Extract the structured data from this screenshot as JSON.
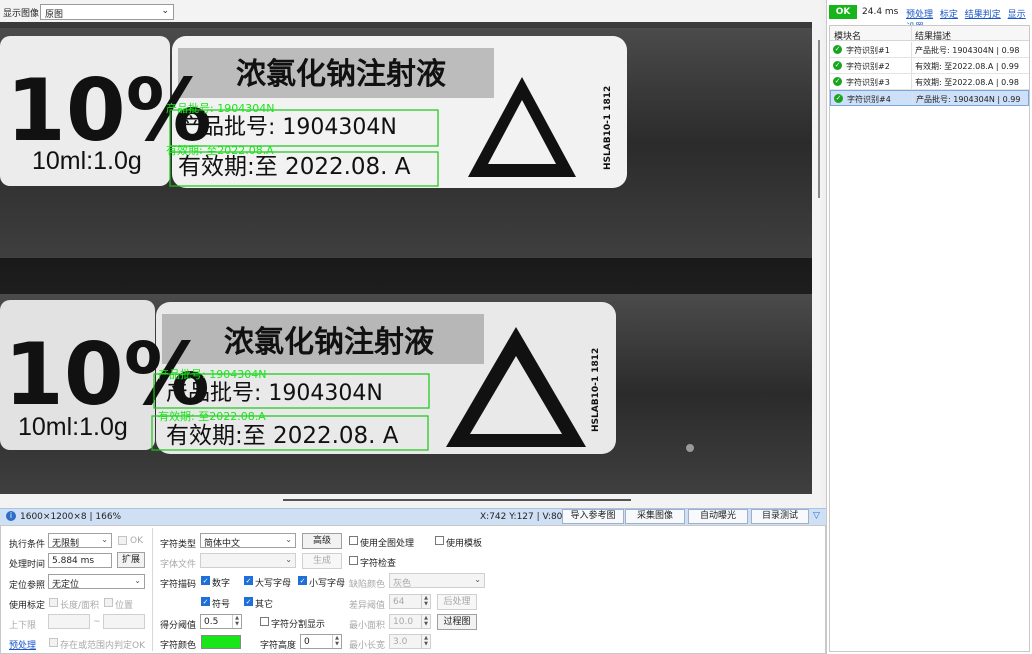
{
  "top": {
    "show_image_label": "显示图像",
    "show_image_value": "原图"
  },
  "viewport": {
    "vial_1": {
      "percent": "10%",
      "volume": "10ml:1.0g",
      "drug_name": "浓氯化钠注射液",
      "batch": "产品批号: 1904304N",
      "expiry": "有效期:至 2022.08. A",
      "lot_code": "HSLAB10-1 1812",
      "ocr_batch": "产品批号: 1904304N",
      "ocr_expiry": "有效期: 至2022.08.A"
    },
    "vial_2": {
      "percent": "10%",
      "volume": "10ml:1.0g",
      "drug_name": "浓氯化钠注射液",
      "batch": "产品批号: 1904304N",
      "expiry": "有效期:至 2022.08. A",
      "lot_code": "HSLAB10-1 1812",
      "ocr_batch": "产品批号: 1904304N",
      "ocr_expiry": "有效期: 至2022.08.A"
    }
  },
  "status": {
    "image_info": "1600×1200×8 | 166%",
    "coords": "X:742 Y:127 | V:80",
    "btn_import_ref": "导入参考图",
    "btn_capture": "采集图像",
    "btn_auto_exposure": "自动曝光",
    "btn_dir_test": "目录测试"
  },
  "params": {
    "exec_cond_label": "执行条件",
    "exec_cond_value": "无限制",
    "ok_label": "OK",
    "proc_time_label": "处理时间",
    "proc_time_value": "5.884 ms",
    "expand_btn": "扩展",
    "pos_ref_label": "定位参照",
    "pos_ref_value": "无定位",
    "use_calib_label": "使用标定",
    "len_area_label": "长度/面积",
    "position_label": "位置",
    "bounds_label": "上下限",
    "tilde": "~",
    "preprocess_link": "预处理",
    "in_range_ok_label": "存在或范围内判定OK",
    "char_type_label": "字符类型",
    "char_type_value": "简体中文",
    "advanced_btn": "高级",
    "use_full_image_label": "使用全图处理",
    "use_template_label": "使用模板",
    "char_file_label": "字体文件",
    "generate_btn": "生成",
    "char_check_label": "字符检查",
    "char_desc_label": "字符描码",
    "digits_label": "数字",
    "upper_label": "大写字母",
    "lower_label": "小写字母",
    "defect_color_label": "缺陷颜色",
    "defect_color_value": "灰色",
    "symbol_label": "符号",
    "other_label": "其它",
    "diff_thresh_label": "差异阈值",
    "diff_thresh_value": "64",
    "post_process_btn": "后处理",
    "score_thresh_label": "得分阈值",
    "score_thresh_value": "0.5",
    "char_split_label": "字符分割显示",
    "min_area_label": "最小面积",
    "min_area_value": "10.0",
    "process_img_btn": "过程图",
    "char_color_label": "字符颜色",
    "char_color": "#19e619",
    "char_height_label": "字符高度",
    "char_height_value": "0",
    "min_width_label": "最小长宽",
    "min_width_value": "3.0"
  },
  "right": {
    "ok": "OK",
    "time": "24.4 ms",
    "link_preprocess": "预处理",
    "link_calib": "标定",
    "link_result_judge": "结果判定",
    "link_display": "显示设置",
    "col_module": "模块名",
    "col_result": "结果描述",
    "rows": [
      {
        "module": "字符识别#1",
        "result": "产品批号: 1904304N | 0.98",
        "selected": false
      },
      {
        "module": "字符识别#2",
        "result": "有效期: 至2022.08.A | 0.99",
        "selected": false
      },
      {
        "module": "字符识别#3",
        "result": "有效期: 至2022.08.A | 0.98",
        "selected": false
      },
      {
        "module": "字符识别#4",
        "result": "产品批号: 1904304N | 0.99",
        "selected": true
      }
    ]
  },
  "colors": {
    "ok_green": "#17b41b",
    "ocr_green": "#19e619",
    "status_blue": "#cfe0f5",
    "link_blue": "#1a56c9"
  }
}
